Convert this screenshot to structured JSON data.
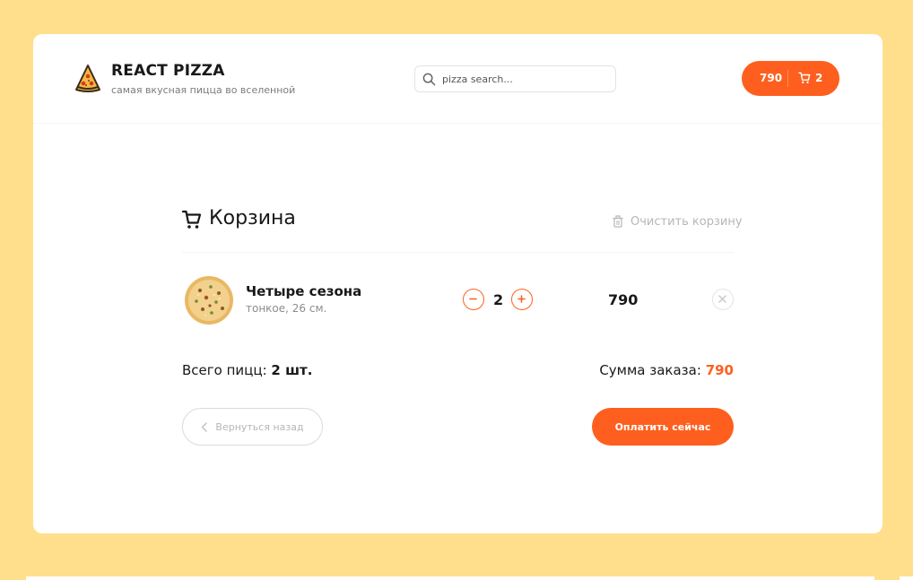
{
  "header": {
    "title": "REACT PIZZA",
    "subtitle": "самая вкусная пицца во вселенной",
    "search_placeholder": "pizza search...",
    "cart_button": {
      "price": "790",
      "count": "2"
    }
  },
  "cart": {
    "title": "Корзина",
    "clear_label": "Очистить корзину",
    "items": [
      {
        "name": "Четыре сезона",
        "details": "тонкое, 26 см.",
        "quantity": "2",
        "price": "790"
      }
    ],
    "summary": {
      "count_label": "Всего пицц:",
      "count_value": "2 шт.",
      "sum_label": "Сумма заказа:",
      "sum_value": "790"
    },
    "back_label": "Вернуться назад",
    "pay_label": "Оплатить сейчас"
  },
  "colors": {
    "accent": "#FE5F1E",
    "background": "#FFDF8C",
    "muted": "#B6B6B6"
  },
  "icons": [
    "pizza-logo-icon",
    "search-icon",
    "cart-icon",
    "trash-icon",
    "minus-icon",
    "plus-icon",
    "close-icon",
    "chevron-left-icon"
  ]
}
